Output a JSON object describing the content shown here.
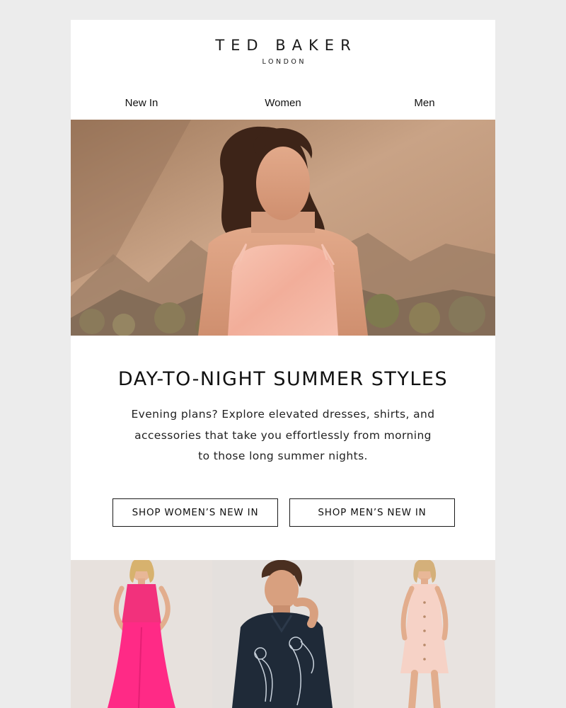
{
  "brand": {
    "name": "TED BAKER",
    "location": "LONDON"
  },
  "nav": {
    "items": [
      {
        "label": "New In"
      },
      {
        "label": "Women"
      },
      {
        "label": "Men"
      }
    ]
  },
  "hero": {
    "image": "woman-in-pink-satin-slip-top-mountain-landscape"
  },
  "promo": {
    "headline": "DAY-TO-NIGHT SUMMER STYLES",
    "body": "Evening plans? Explore elevated dresses, shirts, and accessories that take you effortlessly from morning to those long summer nights."
  },
  "cta": {
    "women_label": "SHOP WOMEN’S NEW IN",
    "men_label": "SHOP MEN’S NEW IN"
  },
  "products": [
    {
      "image": "woman-in-hot-pink-satin-co-ord"
    },
    {
      "image": "man-in-navy-floral-embroidered-shirt"
    },
    {
      "image": "woman-in-pale-pink-button-front-dress"
    }
  ],
  "colors": {
    "background": "#ececec",
    "card": "#ffffff",
    "text": "#111111",
    "border": "#1a1a1a",
    "pink": "#ff2a86",
    "blush": "#f6c8b9",
    "navy": "#1f2a38"
  }
}
